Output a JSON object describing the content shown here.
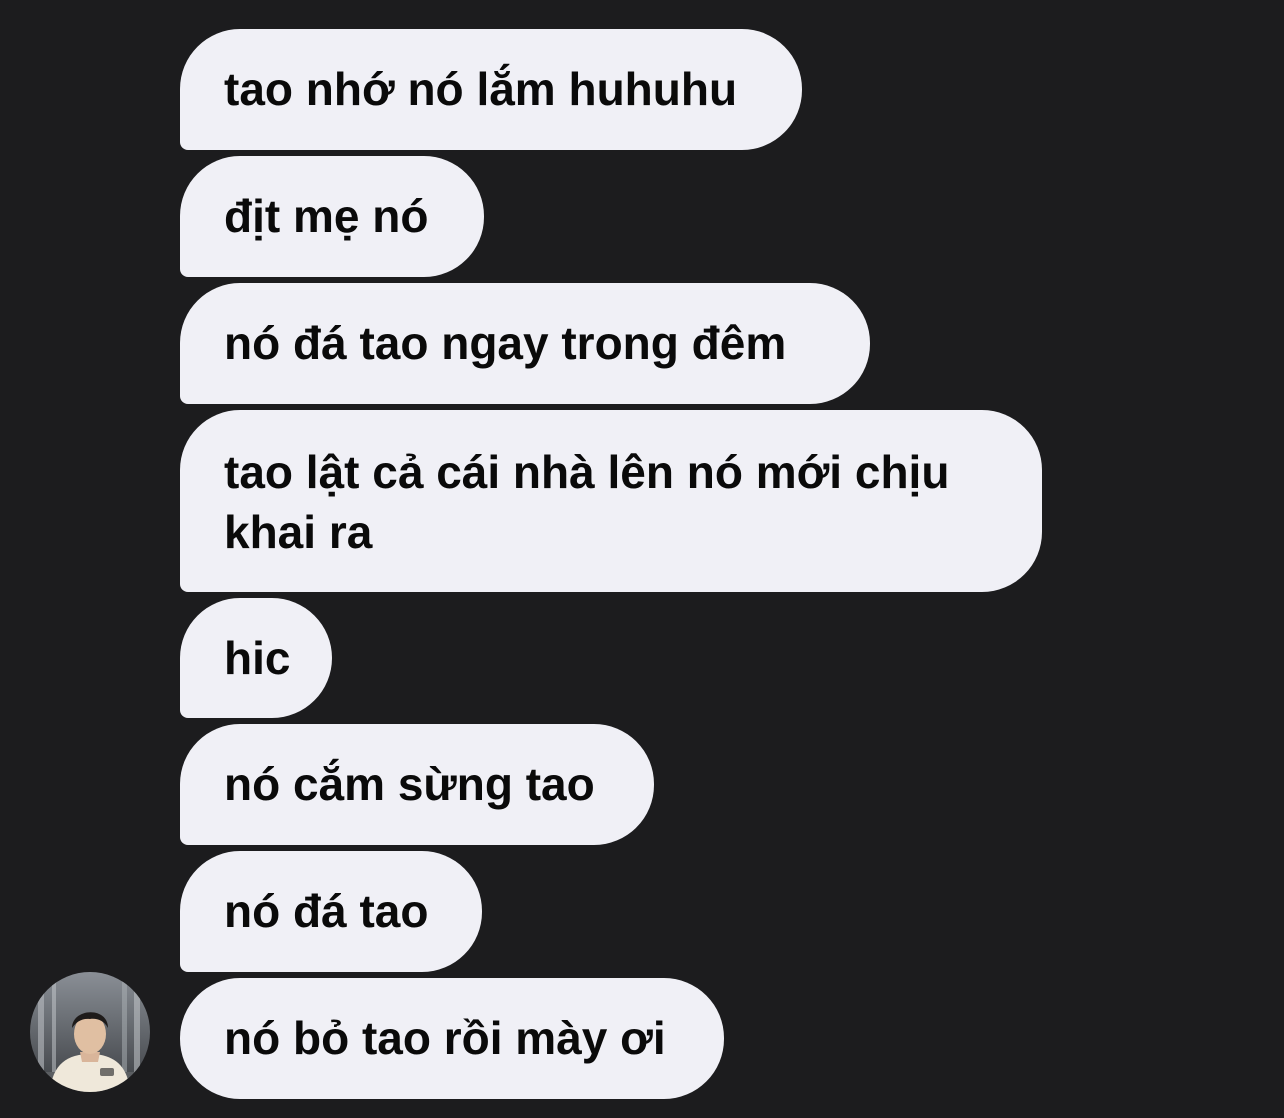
{
  "conversation": {
    "messages": [
      "tao nhớ nó lắm huhuhu",
      "địt mẹ nó",
      "nó đá tao ngay trong đêm",
      "tao lật cả cái nhà lên nó mới chịu khai ra",
      "hic",
      "nó cắm sừng tao",
      "nó đá tao",
      "nó bỏ tao rồi mày ơi"
    ]
  },
  "sender": {
    "avatar_icon": "user-photo-avatar"
  },
  "colors": {
    "background": "#1c1c1e",
    "bubble": "#f0f0f6",
    "text": "#0a0a0a"
  }
}
